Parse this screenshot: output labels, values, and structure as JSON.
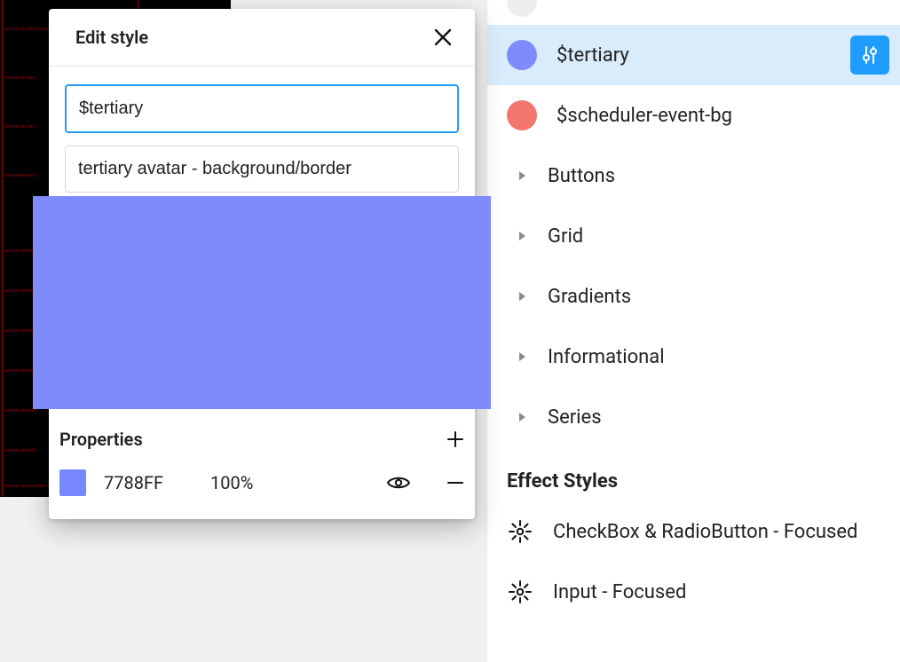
{
  "panel": {
    "title": "Edit style",
    "name_value": "$tertiary",
    "desc_value": "tertiary avatar - background/border",
    "preview_color": "#7e8bfb",
    "properties_label": "Properties",
    "property": {
      "hex": "7788FF",
      "opacity": "100%",
      "swatch": "#7788FF"
    }
  },
  "sidebar": {
    "cut_above_label": "…",
    "styles": [
      {
        "name": "$tertiary",
        "swatch": "#7e8bfb",
        "selected": true
      },
      {
        "name": "$scheduler-event-bg",
        "swatch": "#f4776f",
        "selected": false
      }
    ],
    "groups": [
      "Buttons",
      "Grid",
      "Gradients",
      "Informational",
      "Series"
    ],
    "effects_header": "Effect Styles",
    "effects": [
      "CheckBox & RadioButton - Focused",
      "Input - Focused"
    ]
  }
}
